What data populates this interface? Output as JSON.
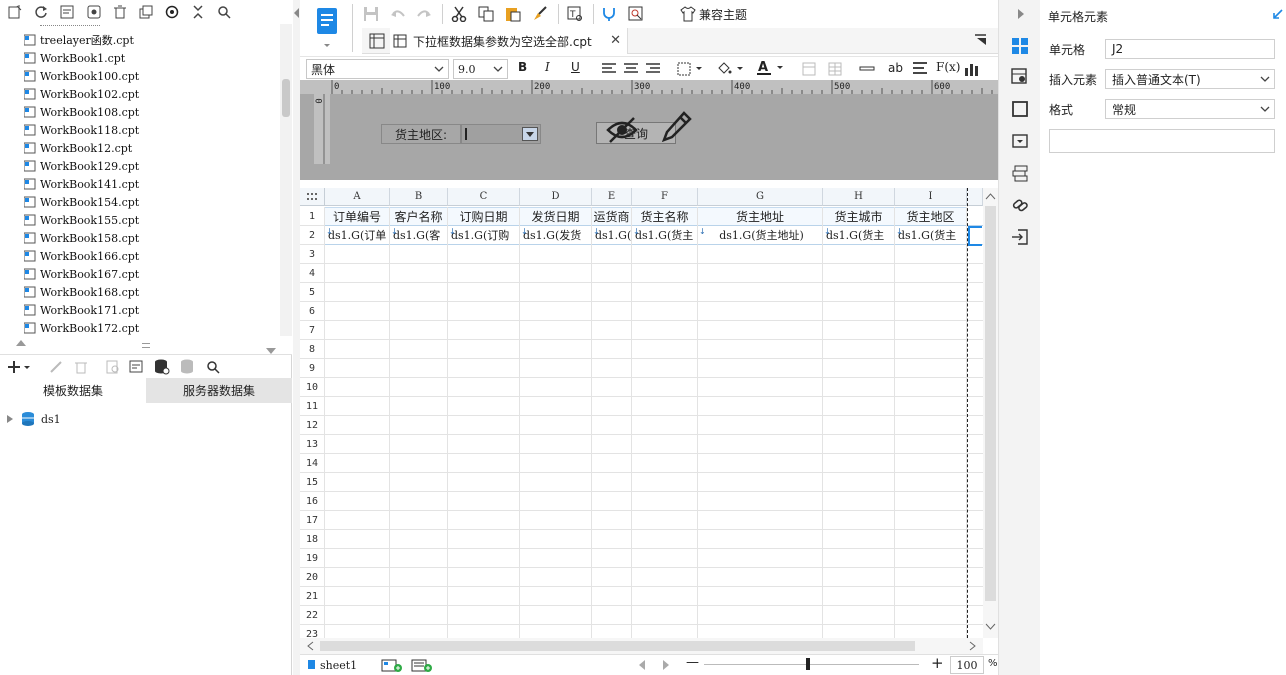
{
  "file_tree": {
    "items": [
      {
        "label": "treelayer函数.cpt"
      },
      {
        "label": "WorkBook1.cpt"
      },
      {
        "label": "WorkBook100.cpt"
      },
      {
        "label": "WorkBook102.cpt"
      },
      {
        "label": "WorkBook108.cpt"
      },
      {
        "label": "WorkBook118.cpt"
      },
      {
        "label": "WorkBook12.cpt"
      },
      {
        "label": "WorkBook129.cpt"
      },
      {
        "label": "WorkBook141.cpt"
      },
      {
        "label": "WorkBook154.cpt"
      },
      {
        "label": "WorkBook155.cpt"
      },
      {
        "label": "WorkBook158.cpt"
      },
      {
        "label": "WorkBook166.cpt"
      },
      {
        "label": "WorkBook167.cpt"
      },
      {
        "label": "WorkBook168.cpt"
      },
      {
        "label": "WorkBook171.cpt"
      },
      {
        "label": "WorkBook172.cpt"
      }
    ]
  },
  "dataset": {
    "tab_template": "模板数据集",
    "tab_server": "服务器数据集",
    "ds_label": "ds1"
  },
  "toolbar": {
    "compat_theme": "兼容主题"
  },
  "editor_tab": {
    "title": "下拉框数据集参数为空选全部.cpt"
  },
  "format": {
    "font": "黑体",
    "size": "9.0",
    "bold": "B",
    "italic": "I",
    "underline": "U",
    "ab": "ab",
    "fx": "F(x)"
  },
  "ruler": {
    "marks": [
      "0",
      "100",
      "200",
      "300",
      "400",
      "500",
      "600"
    ],
    "vmark": "0"
  },
  "param_panel": {
    "label": "货主地区:",
    "query_button": "查询"
  },
  "sheet": {
    "columns": [
      "A",
      "B",
      "C",
      "D",
      "E",
      "F",
      "G",
      "H",
      "I"
    ],
    "rows": [
      "1",
      "2",
      "3",
      "4",
      "5",
      "6",
      "7",
      "8",
      "9",
      "10",
      "11",
      "12",
      "13",
      "14",
      "15",
      "16",
      "17",
      "18",
      "19",
      "20",
      "21",
      "22",
      "23"
    ],
    "row1": [
      "订单编号",
      "客户名称",
      "订购日期",
      "发货日期",
      "运货商",
      "货主名称",
      "货主地址",
      "货主城市",
      "货主地区"
    ],
    "row2": [
      "ds1.G(订单",
      "ds1.G(客",
      "ds1.G(订购",
      "ds1.G(发货",
      "ds1.G(",
      "ds1.G(货主",
      "ds1.G(货主地址)",
      "ds1.G(货主",
      "ds1.G(货主"
    ]
  },
  "bottom_bar": {
    "sheet_tab": "sheet1",
    "zoom": "100",
    "zoom_unit": "%",
    "minus": "—",
    "plus": "+"
  },
  "right_panel": {
    "title": "单元格元素",
    "cell_label": "单元格",
    "cell_value": "J2",
    "insert_label": "插入元素",
    "insert_value": "插入普通文本(T)",
    "format_label": "格式",
    "format_value": "常规"
  },
  "colors": {
    "accent_blue": "#1e88e5",
    "grid_header": "#f2f6fa",
    "design_bg": "#a7a7a7"
  }
}
